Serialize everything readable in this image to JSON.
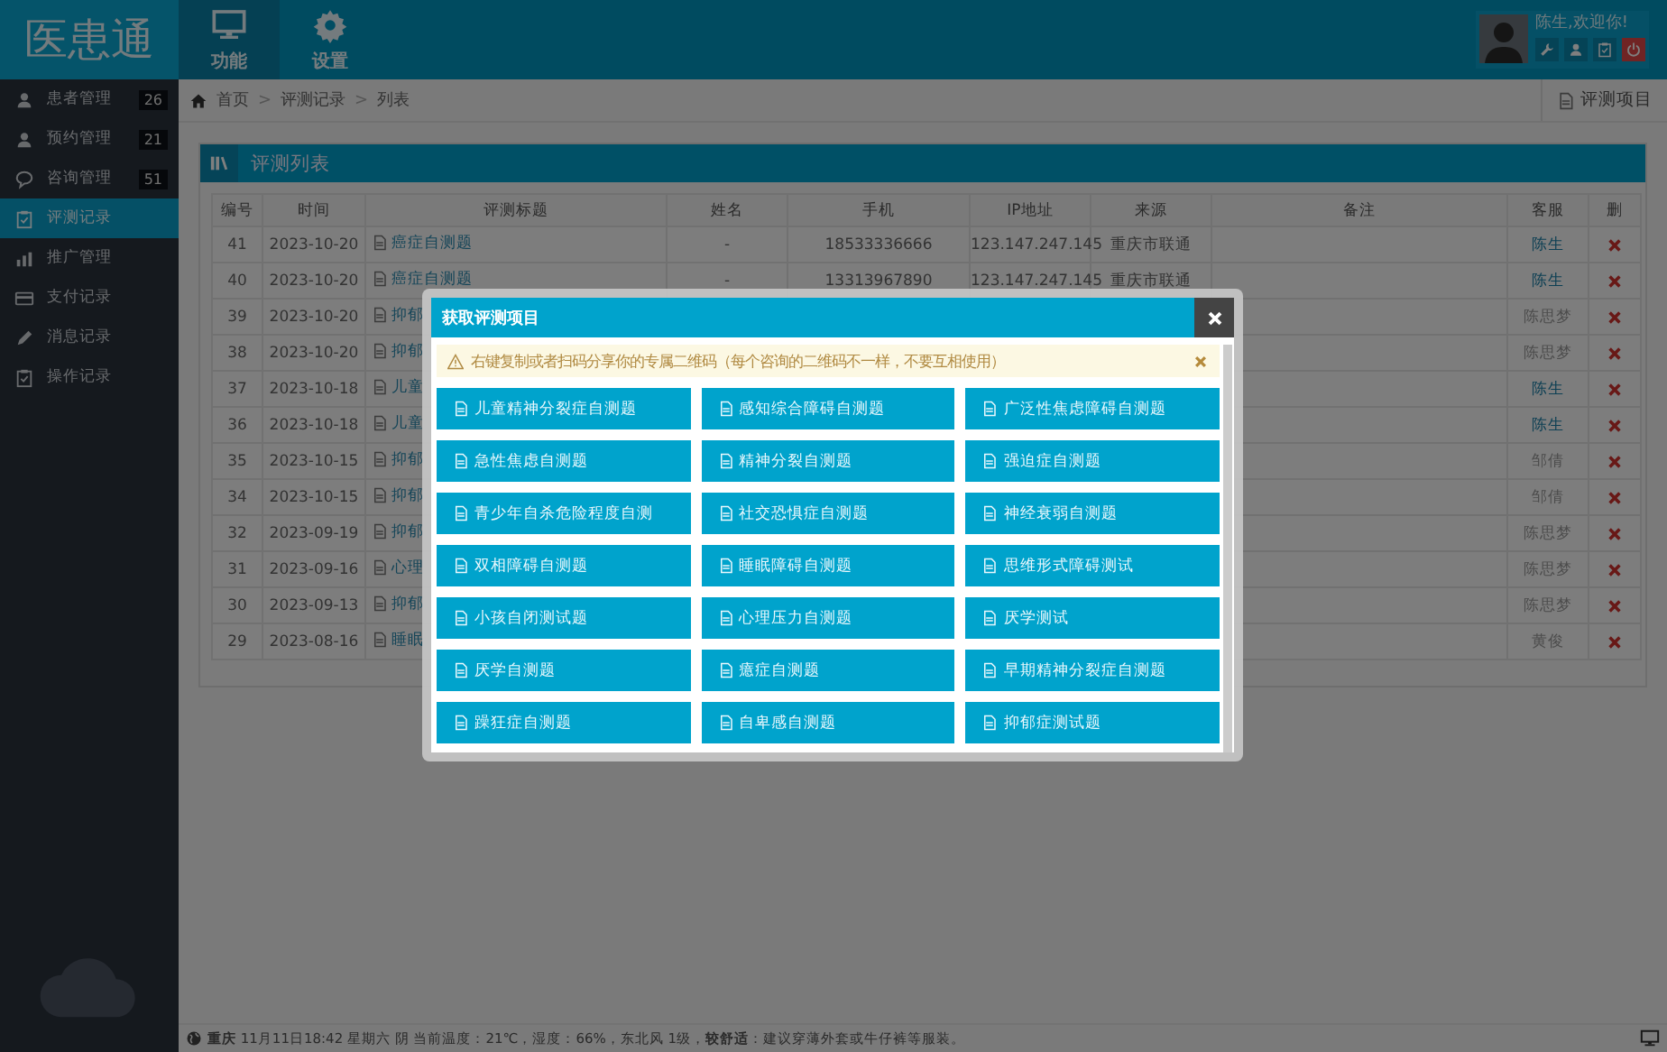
{
  "app": {
    "logo": "医患通"
  },
  "topbar": {
    "tabs": [
      {
        "label": "功能",
        "selected": true
      },
      {
        "label": "设置",
        "selected": false
      }
    ],
    "user": {
      "greeting": "陈生,欢迎你!"
    }
  },
  "sidebar": {
    "items": [
      {
        "label": "患者管理",
        "count": "26",
        "selected": false
      },
      {
        "label": "预约管理",
        "count": "21",
        "selected": false
      },
      {
        "label": "咨询管理",
        "count": "51",
        "selected": false
      },
      {
        "label": "评测记录",
        "selected": true
      },
      {
        "label": "推广管理",
        "selected": false
      },
      {
        "label": "支付记录",
        "selected": false
      },
      {
        "label": "消息记录",
        "selected": false
      },
      {
        "label": "操作记录",
        "selected": false
      }
    ]
  },
  "breadcrumb": {
    "items": [
      "首页",
      "评测记录",
      "列表"
    ],
    "separator": ">",
    "action": "评测项目"
  },
  "panel": {
    "title": "评测列表"
  },
  "table": {
    "columns": [
      "编号",
      "时间",
      "评测标题",
      "姓名",
      "手机",
      "IP地址",
      "来源",
      "备注",
      "客服",
      "删"
    ],
    "rows": [
      {
        "id": "41",
        "date": "2023-10-20",
        "title": "癌症自测题",
        "name": "-",
        "phone": "18533336666",
        "ip": "123.147.247.145",
        "source": "重庆市联通",
        "agent": "陈生",
        "agent_link": true
      },
      {
        "id": "40",
        "date": "2023-10-20",
        "title": "癌症自测题",
        "name": "-",
        "phone": "13313967890",
        "ip": "123.147.247.145",
        "source": "重庆市联通",
        "agent": "陈生",
        "agent_link": true
      },
      {
        "id": "39",
        "date": "2023-10-20",
        "title": "抑郁",
        "agent": "陈思梦",
        "agent_link": false
      },
      {
        "id": "38",
        "date": "2023-10-20",
        "title": "抑郁",
        "agent": "陈思梦",
        "agent_link": false
      },
      {
        "id": "37",
        "date": "2023-10-18",
        "title": "儿童",
        "agent": "陈生",
        "agent_link": true
      },
      {
        "id": "36",
        "date": "2023-10-18",
        "title": "儿童",
        "agent": "陈生",
        "agent_link": true
      },
      {
        "id": "35",
        "date": "2023-10-15",
        "title": "抑郁",
        "agent": "邹倩",
        "agent_link": false
      },
      {
        "id": "34",
        "date": "2023-10-15",
        "title": "抑郁",
        "agent": "邹倩",
        "agent_link": false
      },
      {
        "id": "32",
        "date": "2023-09-19",
        "title": "抑郁",
        "agent": "陈思梦",
        "agent_link": false
      },
      {
        "id": "31",
        "date": "2023-09-16",
        "title": "心理",
        "agent": "陈思梦",
        "agent_link": false
      },
      {
        "id": "30",
        "date": "2023-09-13",
        "title": "抑郁",
        "agent": "陈思梦",
        "agent_link": false
      },
      {
        "id": "29",
        "date": "2023-08-16",
        "title": "睡眠",
        "agent": "黄俊",
        "agent_link": false
      }
    ]
  },
  "modal": {
    "title": "获取评测项目",
    "alert": "右键复制或者扫码分享你的专属二维码（每个咨询的二维码不一样，不要互相使用）",
    "items": [
      "儿童精神分裂症自测题",
      "感知综合障碍自测题",
      "广泛性焦虑障碍自测题",
      "急性焦虑自测题",
      "精神分裂自测题",
      "强迫症自测题",
      "青少年自杀危险程度自测",
      "社交恐惧症自测题",
      "神经衰弱自测题",
      "双相障碍自测题",
      "睡眠障碍自测题",
      "思维形式障碍测试",
      "小孩自闭测试题",
      "心理压力自测题",
      "厌学测试",
      "厌学自测题",
      "癔症自测题",
      "早期精神分裂症自测题",
      "躁狂症自测题",
      "自卑感自测题",
      "抑郁症测试题"
    ]
  },
  "status_bar": {
    "text": "**重庆** 11月11日18:42 星期六 阴 当前温度：21℃，湿度：66%，东北风 1级，**较舒适**：建议穿薄外套或牛仔裤等服装。"
  }
}
